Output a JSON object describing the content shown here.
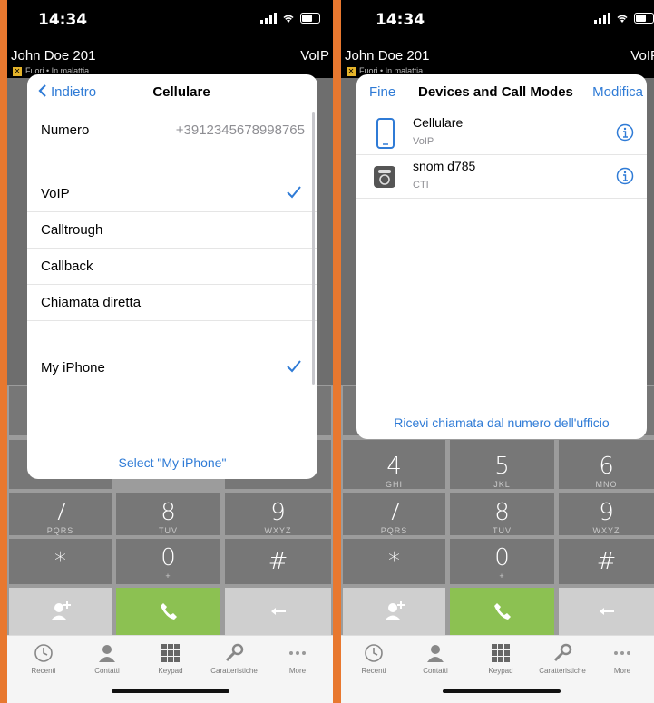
{
  "status": {
    "time": "14:34"
  },
  "header": {
    "user": "John Doe 201",
    "mode": "VoIP",
    "presence_left": "Fuori • In malattia",
    "presence_right": "Fuori • In malattia"
  },
  "left_sheet": {
    "back": "Indietro",
    "title": "Cellulare",
    "number_label": "Numero",
    "number_value": "+3912345678998765",
    "modes": [
      {
        "label": "VoIP",
        "checked": true
      },
      {
        "label": "Calltrough",
        "checked": false
      },
      {
        "label": "Callback",
        "checked": false
      },
      {
        "label": "Chiamata diretta",
        "checked": false
      }
    ],
    "device": {
      "label": "My iPhone",
      "checked": true
    },
    "select_link": "Select \"My iPhone\""
  },
  "right_sheet": {
    "done": "Fine",
    "title": "Devices and Call Modes",
    "edit": "Modifica",
    "devices": [
      {
        "name": "Cellulare",
        "mode": "VoIP",
        "icon": "smartphone-icon"
      },
      {
        "name": "snom d785",
        "mode": "CTI",
        "icon": "desk-phone-icon"
      }
    ],
    "office_link": "Ricevi chiamata dal numero dell'ufficio"
  },
  "keypad": {
    "k4": {
      "digit": "4",
      "letters": "GHI"
    },
    "k5": {
      "digit": "5",
      "letters": "JKL"
    },
    "k6": {
      "digit": "6",
      "letters": "MNO"
    },
    "k7": {
      "digit": "7",
      "letters": "PQRS"
    },
    "k8": {
      "digit": "8",
      "letters": "TUV"
    },
    "k9": {
      "digit": "9",
      "letters": "WXYZ"
    },
    "star": {
      "digit": "*"
    },
    "k0": {
      "digit": "0",
      "letters": "+"
    },
    "hash": {
      "digit": "#"
    }
  },
  "tabs": [
    "Recenti",
    "Contatti",
    "Keypad",
    "Caratteristiche",
    "More"
  ],
  "colors": {
    "accent": "#2f7bd6",
    "call_green": "#8cc152",
    "frame": "#e8782f"
  }
}
